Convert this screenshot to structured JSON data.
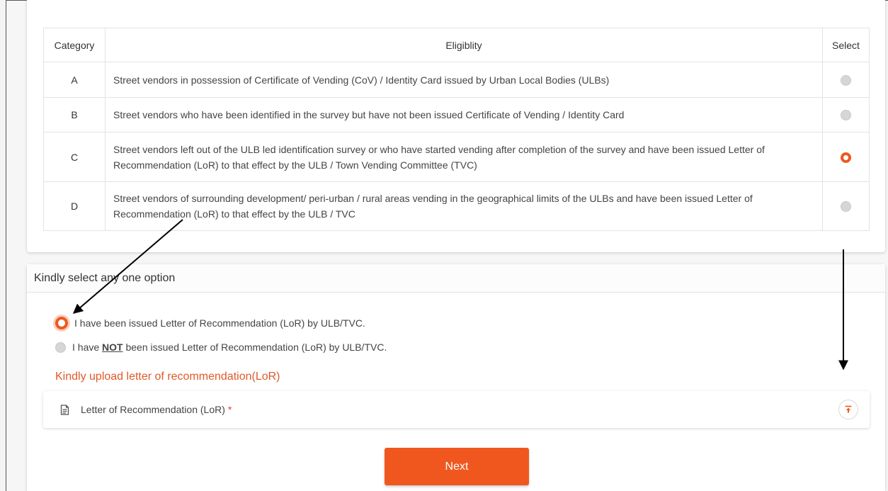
{
  "table": {
    "headers": {
      "category": "Category",
      "eligibility": "Eligiblity",
      "select": "Select"
    },
    "rows": [
      {
        "category": "A",
        "text": "Street vendors in possession of Certificate of Vending (CoV) / Identity Card issued by Urban Local Bodies (ULBs)",
        "selected": false
      },
      {
        "category": "B",
        "text": "Street vendors who have been identified in the survey but have not been issued Certificate of Vending / Identity Card",
        "selected": false
      },
      {
        "category": "C",
        "text": "Street vendors left out of the ULB led identification survey or who have started vending after completion of the survey and have been issued Letter of Recommendation (LoR) to that effect by the ULB / Town Vending Committee (TVC)",
        "selected": true
      },
      {
        "category": "D",
        "text": "Street vendors of surrounding development/ peri-urban / rural areas vending in the geographical limits of the ULBs and have been issued Letter of Recommendation (LoR) to that effect by the ULB / TVC",
        "selected": false
      }
    ]
  },
  "options": {
    "heading": "Kindly select any one option",
    "issued_label": "I have been issued Letter of Recommendation (LoR) by ULB/TVC.",
    "not_issued_prefix": "I have ",
    "not_issued_emphasis": "NOT",
    "not_issued_suffix": " been issued Letter of Recommendation (LoR) by ULB/TVC.",
    "selected": "issued"
  },
  "upload": {
    "title": "Kindly upload letter of recommendation(LoR)",
    "file_label": "Letter of Recommendation (LoR)",
    "required_mark": "*"
  },
  "next_label": "Next",
  "colors": {
    "accent": "#f0571f",
    "radio_checked": "#ec5a1e",
    "upload_title": "#e05a28",
    "required": "#e0402f"
  },
  "icons": {
    "file": "document-icon",
    "upload": "upload-icon",
    "annotation": "arrow-annotation"
  }
}
